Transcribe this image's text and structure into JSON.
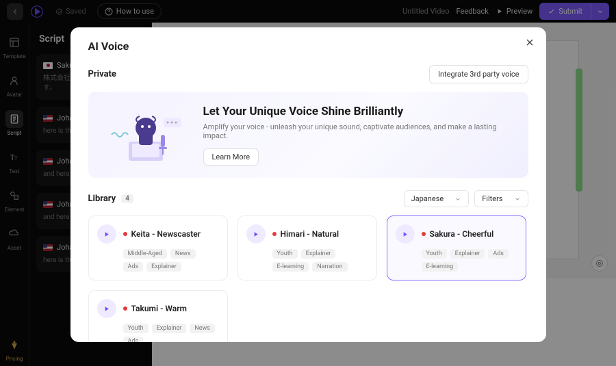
{
  "topbar": {
    "saved": "Saved",
    "howto": "How to use",
    "title": "Untitled Video",
    "feedback": "Feedback",
    "preview": "Preview",
    "submit": "Submit"
  },
  "nav": {
    "template": "Template",
    "avatar": "Avatar",
    "script": "Script",
    "text": "Text",
    "element": "Element",
    "asset": "Asset",
    "pricing": "Pricing"
  },
  "scriptPanel": {
    "title": "Script",
    "items": [
      {
        "voice": "Sakura",
        "flag": "jp",
        "text": "株式会社/レゼンテーションです。"
      },
      {
        "voice": "Johanna",
        "flag": "us",
        "text": "here is the"
      },
      {
        "voice": "Johanna",
        "flag": "us",
        "text": "and here"
      },
      {
        "voice": "Johanna",
        "flag": "us",
        "text": "and here"
      },
      {
        "voice": "Johanna",
        "flag": "us",
        "text": "here is the"
      }
    ]
  },
  "modal": {
    "title": "AI Voice",
    "private": "Private",
    "integrate": "Integrate 3rd party voice",
    "heroTitle": "Let Your Unique Voice Shine Brilliantly",
    "heroDesc": "Amplify your voice - unleash your unique sound, captivate audiences, and make a lasting impact.",
    "learnMore": "Learn More",
    "library": "Library",
    "libraryCount": "4",
    "language": "Japanese",
    "filters": "Filters",
    "voices": [
      {
        "name": "Keita - Newscaster",
        "tags": [
          "Middle-Aged",
          "News",
          "Ads",
          "Explainer"
        ],
        "selected": false
      },
      {
        "name": "Himari - Natural",
        "tags": [
          "Youth",
          "Explainer",
          "E-learning",
          "Narration"
        ],
        "selected": false
      },
      {
        "name": "Sakura - Cheerful",
        "tags": [
          "Youth",
          "Explainer",
          "Ads",
          "E-learning"
        ],
        "selected": true
      },
      {
        "name": "Takumi - Warm",
        "tags": [
          "Youth",
          "Explainer",
          "News",
          "Ads"
        ],
        "selected": false
      }
    ]
  }
}
